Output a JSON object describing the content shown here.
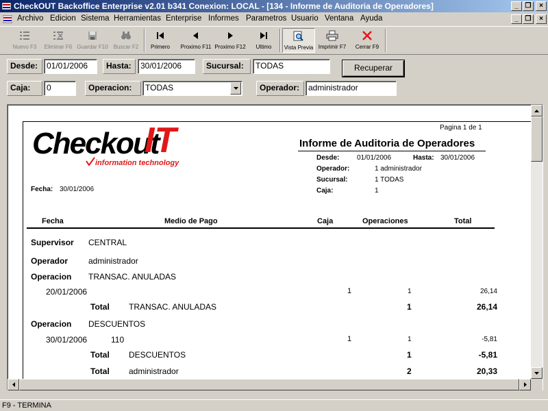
{
  "window": {
    "title": "CheckOUT Backoffice Enterprise v2.01 b341 Conexion: LOCAL - [134 - Informe de Auditoria de Operadores]"
  },
  "menu": [
    "Archivo",
    "Edicion",
    "Sistema",
    "Herramientas",
    "Enterprise",
    "Informes",
    "Parametros",
    "Usuario",
    "Ventana",
    "Ayuda"
  ],
  "toolbar": {
    "nuevo": "Nuevo F3",
    "eliminar": "Eliminar F6",
    "guardar": "Guardar F10",
    "buscar": "Buscar F2",
    "primero": "Primero",
    "anterior": "Proximo F11",
    "siguiente": "Proximo F12",
    "ultimo": "Ultimo",
    "vista_previa": "Vista Previa",
    "imprimir": "Imprimir F7",
    "cerrar": "Cerrar F9"
  },
  "filters": {
    "desde_label": "Desde:",
    "desde_value": "01/01/2006",
    "hasta_label": "Hasta:",
    "hasta_value": "30/01/2006",
    "sucursal_label": "Sucursal:",
    "sucursal_value": "TODAS",
    "recuperar_label": "Recuperar",
    "caja_label": "Caja:",
    "caja_value": "0",
    "operacion_label": "Operacion:",
    "operacion_value": "TODAS",
    "operador_label": "Operador:",
    "operador_value": "administrador"
  },
  "report": {
    "page_info": "Pagina 1 de 1",
    "logo_main": "Checkout",
    "logo_it": "IT",
    "logo_tagline": "information technology",
    "title": "Informe de Auditoria de Operadores",
    "desde_label": "Desde:",
    "desde_value": "01/01/2006",
    "hasta_label": "Hasta:",
    "hasta_value": "30/01/2006",
    "operador_label": "Operador:",
    "operador_value": "1 administrador",
    "sucursal_label": "Sucursal:",
    "sucursal_value": "1 TODAS",
    "caja_label": "Caja:",
    "caja_value": "1",
    "fecha_label": "Fecha:",
    "fecha_value": "30/01/2006",
    "columns": {
      "fecha": "Fecha",
      "medio_pago": "Medio de Pago",
      "caja": "Caja",
      "operaciones": "Operaciones",
      "total": "Total"
    },
    "supervisor_label": "Supervisor",
    "supervisor_value": "CENTRAL",
    "operador_row_label": "Operador",
    "operador_row_value": "administrador",
    "groups": [
      {
        "label": "Operacion",
        "name": "TRANSAC. ANULADAS",
        "detail": {
          "fecha": "20/01/2006",
          "medio": "",
          "caja": "1",
          "operaciones": "1",
          "total": "26,14"
        },
        "total_label": "Total",
        "total_name": "TRANSAC. ANULADAS",
        "total_ops": "1",
        "total_value": "26,14"
      },
      {
        "label": "Operacion",
        "name": "DESCUENTOS",
        "detail": {
          "fecha": "30/01/2006",
          "medio": "110",
          "caja": "1",
          "operaciones": "1",
          "total": "-5,81"
        },
        "total_label": "Total",
        "total_name": "DESCUENTOS",
        "total_ops": "1",
        "total_value": "-5,81"
      }
    ],
    "grand_total_label": "Total",
    "grand_total_name": "administrador",
    "grand_total_ops": "2",
    "grand_total_value": "20,33"
  },
  "status": {
    "text": "F9 - TERMINA"
  },
  "colors": {
    "title_start": "#0a246a",
    "title_end": "#a6caf0",
    "logo_red": "#e01818",
    "face": "#d4d0c8"
  }
}
